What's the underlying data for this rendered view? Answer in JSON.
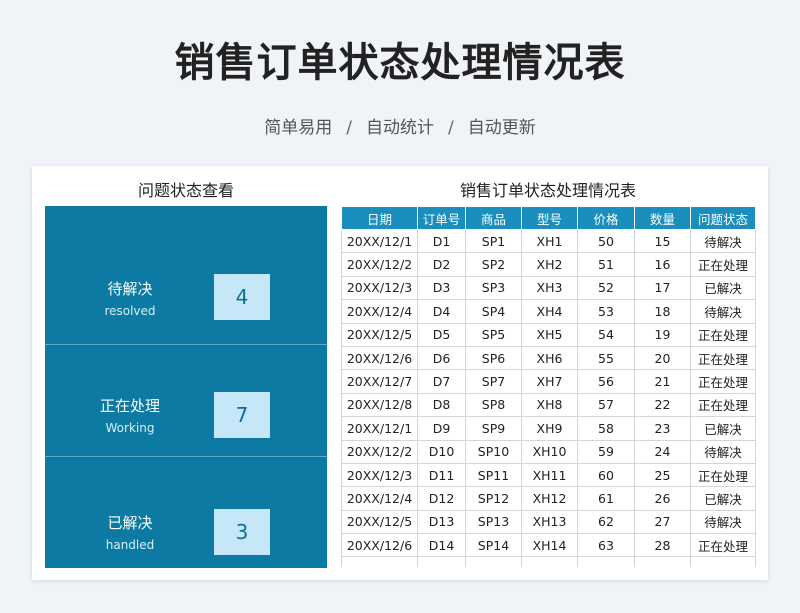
{
  "header": {
    "title": "销售订单状态处理情况表",
    "tagline": [
      "简单易用",
      "自动统计",
      "自动更新"
    ],
    "separator": "/"
  },
  "status_panel": {
    "title": "问题状态查看",
    "items": [
      {
        "label": "待解决",
        "label_en": "resolved",
        "count": "4"
      },
      {
        "label": "正在处理",
        "label_en": "Working",
        "count": "7"
      },
      {
        "label": "已解决",
        "label_en": "handled",
        "count": "3"
      }
    ]
  },
  "orders": {
    "title": "销售订单状态处理情况表",
    "columns": [
      "日期",
      "订单号",
      "商品",
      "型号",
      "价格",
      "数量",
      "问题状态"
    ],
    "rows": [
      [
        "20XX/12/1",
        "D1",
        "SP1",
        "XH1",
        "50",
        "15",
        "待解决"
      ],
      [
        "20XX/12/2",
        "D2",
        "SP2",
        "XH2",
        "51",
        "16",
        "正在处理"
      ],
      [
        "20XX/12/3",
        "D3",
        "SP3",
        "XH3",
        "52",
        "17",
        "已解决"
      ],
      [
        "20XX/12/4",
        "D4",
        "SP4",
        "XH4",
        "53",
        "18",
        "待解决"
      ],
      [
        "20XX/12/5",
        "D5",
        "SP5",
        "XH5",
        "54",
        "19",
        "正在处理"
      ],
      [
        "20XX/12/6",
        "D6",
        "SP6",
        "XH6",
        "55",
        "20",
        "正在处理"
      ],
      [
        "20XX/12/7",
        "D7",
        "SP7",
        "XH7",
        "56",
        "21",
        "正在处理"
      ],
      [
        "20XX/12/8",
        "D8",
        "SP8",
        "XH8",
        "57",
        "22",
        "正在处理"
      ],
      [
        "20XX/12/1",
        "D9",
        "SP9",
        "XH9",
        "58",
        "23",
        "已解决"
      ],
      [
        "20XX/12/2",
        "D10",
        "SP10",
        "XH10",
        "59",
        "24",
        "待解决"
      ],
      [
        "20XX/12/3",
        "D11",
        "SP11",
        "XH11",
        "60",
        "25",
        "正在处理"
      ],
      [
        "20XX/12/4",
        "D12",
        "SP12",
        "XH12",
        "61",
        "26",
        "已解决"
      ],
      [
        "20XX/12/5",
        "D13",
        "SP13",
        "XH13",
        "62",
        "27",
        "待解决"
      ],
      [
        "20XX/12/6",
        "D14",
        "SP14",
        "XH14",
        "63",
        "28",
        "正在处理"
      ]
    ]
  },
  "colors": {
    "panel": "#0c7aa3",
    "header_cell": "#1a8fbd",
    "count_box": "#c6e7f7"
  }
}
